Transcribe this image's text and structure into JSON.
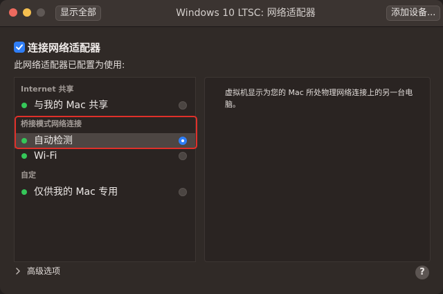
{
  "window": {
    "title": "Windows 10 LTSC: 网络适配器",
    "show_all_label": "显示全部",
    "add_device_label": "添加设备..."
  },
  "connect": {
    "label": "连接网络适配器",
    "checked": true
  },
  "config_label": "此网络适配器已配置为使用:",
  "groups": [
    {
      "title": "Internet 共享",
      "items": [
        {
          "label": "与我的 Mac 共享",
          "status": "green",
          "selected": false
        }
      ]
    },
    {
      "title": "桥接模式网络连接",
      "items": [
        {
          "label": "自动检测",
          "status": "green",
          "selected": true
        },
        {
          "label": "Wi-Fi",
          "status": "green",
          "selected": false
        }
      ]
    },
    {
      "title": "自定",
      "items": [
        {
          "label": "仅供我的 Mac 专用",
          "status": "green",
          "selected": false
        }
      ]
    }
  ],
  "description": "虚拟机显示为您的 Mac 所处物理网络连接上的另一台电脑。",
  "advanced_label": "高级选项",
  "help_label": "?",
  "colors": {
    "accent": "#2f7ef6",
    "status_green": "#35c759",
    "highlight_red": "#e0302a"
  }
}
